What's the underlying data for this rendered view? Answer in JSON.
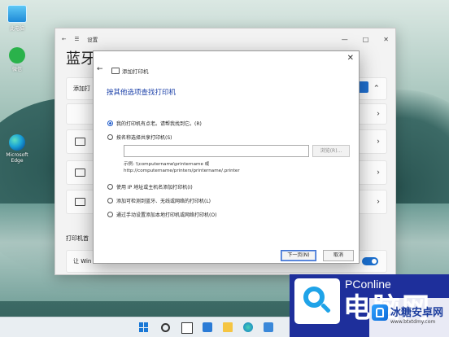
{
  "desktop": {
    "icons": [
      {
        "label": "此电脑",
        "icon": "computer-icon"
      },
      {
        "label": "微信",
        "icon": "wechat-icon"
      },
      {
        "label": "Microsoft Edge",
        "icon": "edge-icon"
      }
    ]
  },
  "settings": {
    "window_title": "设置",
    "page_title": "蓝牙",
    "add_row_label": "添加打",
    "section_label": "打印机首",
    "bottom_row_label": "让 Win",
    "icons": [
      "back-arrow-icon",
      "hamburger-menu-icon",
      "minimize-icon",
      "maximize-icon",
      "close-icon",
      "chevron-right-icon"
    ]
  },
  "dialog": {
    "title": "添加打印机",
    "heading": "按其他选项查找打印机",
    "options": [
      {
        "label": "我的打印机有点老。请帮我找到它。(R)",
        "selected": true
      },
      {
        "label": "按名称选择共享打印机(S)",
        "selected": false
      },
      {
        "label": "使用 IP 地址或主机名添加打印机(I)",
        "selected": false
      },
      {
        "label": "添加可检测到蓝牙、无线或网络的打印机(L)",
        "selected": false
      },
      {
        "label": "通过手动设置添加本地打印机或网络打印机(O)",
        "selected": false
      }
    ],
    "path_input_value": "",
    "browse_label": "浏览(R)...",
    "example_line1": "示例: \\\\computername\\printername 或",
    "example_line2": "http://computername/printers/printername/.printer",
    "next_label": "下一页(N)",
    "cancel_label": "取消"
  },
  "taskbar": {
    "icons": [
      "windows-start-icon",
      "search-icon",
      "task-view-icon",
      "widgets-icon",
      "file-explorer-icon",
      "edge-icon",
      "store-icon"
    ]
  },
  "watermarks": {
    "brand": "PConline",
    "brand_cn": "电脑网",
    "site_cn": "冰糖安卓网",
    "site_url": "www.btxtdmy.com"
  },
  "colors": {
    "accent": "#1a58c9",
    "heading": "#1a3fa8",
    "watermark_bg": "#1e2f9b"
  }
}
